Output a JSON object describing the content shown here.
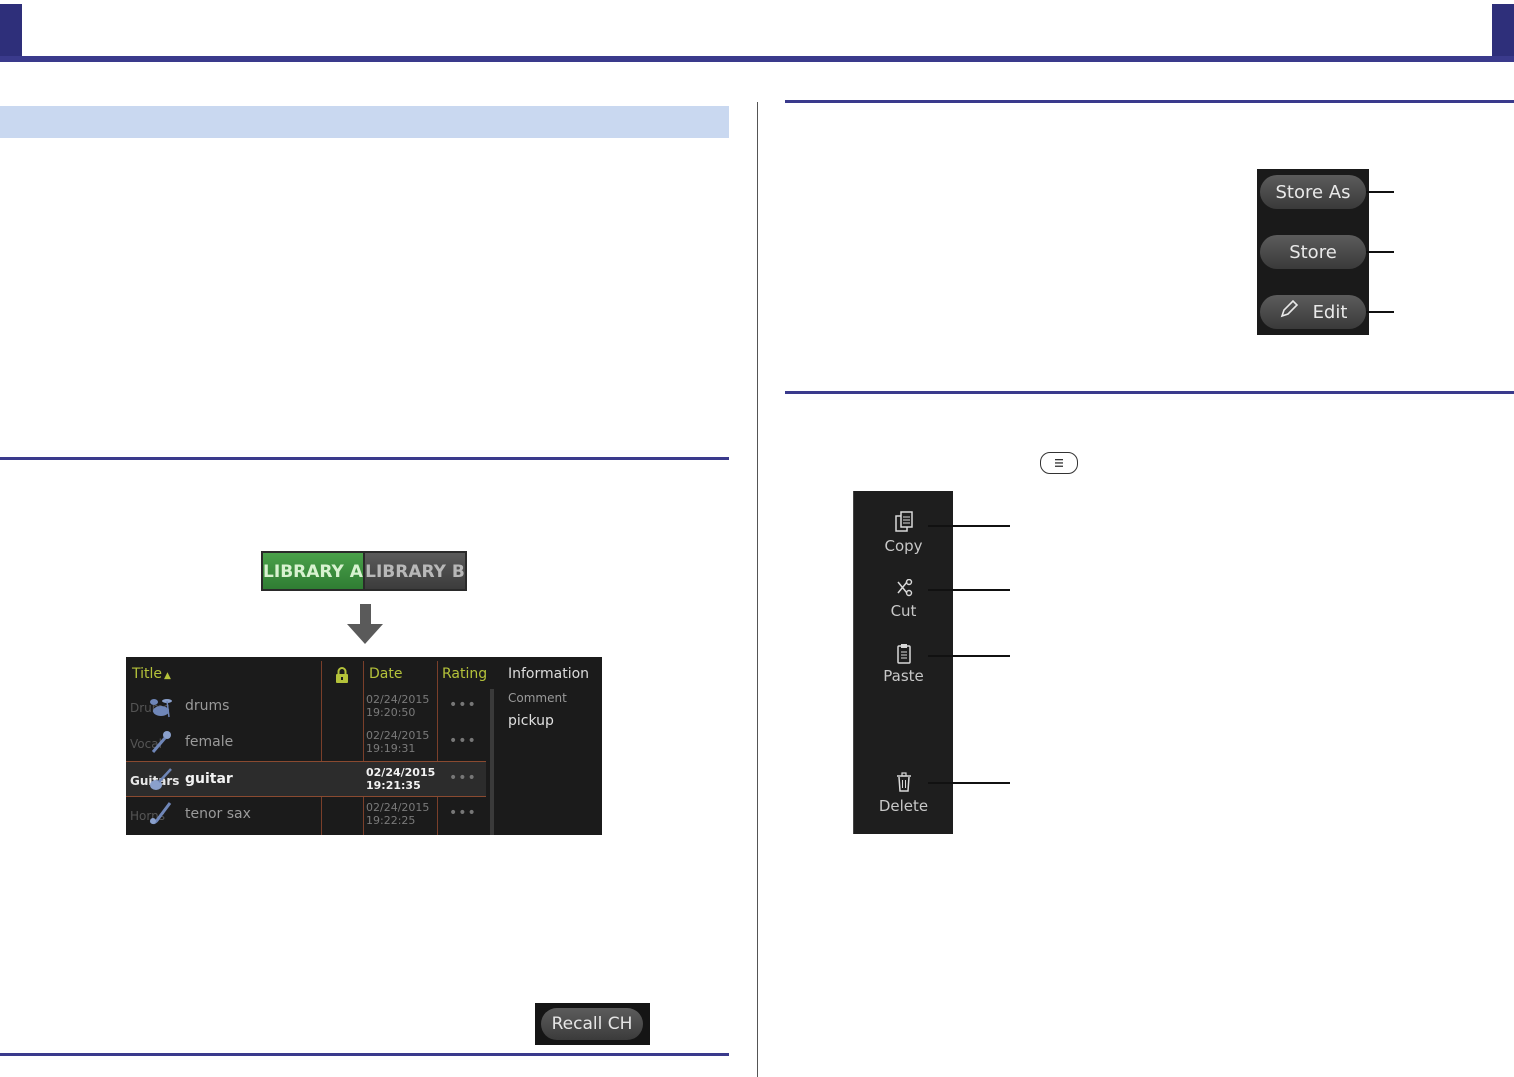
{
  "library_tabs": {
    "tab_a": "LIBRARY A",
    "tab_b": "LIBRARY B"
  },
  "library_table": {
    "headers": {
      "title": "Title",
      "sort_indicator": "▲",
      "date": "Date",
      "rating": "Rating",
      "information": "Information"
    },
    "rows": [
      {
        "category": "Drums",
        "title": "drums",
        "date": "02/24/2015",
        "time": "19:20:50",
        "rating": "•••"
      },
      {
        "category": "Vocal",
        "title": "female",
        "date": "02/24/2015",
        "time": "19:19:31",
        "rating": "•••"
      },
      {
        "category": "Guitars",
        "title": "guitar",
        "date": "02/24/2015",
        "time": "19:21:35",
        "rating": "•••"
      },
      {
        "category": "Horns",
        "title": "tenor sax",
        "date": "02/24/2015",
        "time": "19:22:25",
        "rating": "•••"
      }
    ],
    "info": {
      "comment_label": "Comment",
      "comment_value": "pickup"
    },
    "icons": [
      "lock-icon",
      "drums-icon",
      "microphone-icon",
      "guitar-icon",
      "saxophone-icon"
    ]
  },
  "recall_button": "Recall CH",
  "store_panel": {
    "store_as": "Store As",
    "store": "Store",
    "edit": "Edit"
  },
  "edit_menu": {
    "copy": "Copy",
    "cut": "Cut",
    "paste": "Paste",
    "delete": "Delete",
    "icons": [
      "copy-icon",
      "scissors-icon",
      "clipboard-icon",
      "trash-icon",
      "menu-icon",
      "pencil-icon"
    ]
  },
  "colors": {
    "header_bar": "#2e2f7a",
    "section_band": "#c9d8f0",
    "library_a_active": "#3c8f3e",
    "table_header_text": "#b4c23a"
  }
}
